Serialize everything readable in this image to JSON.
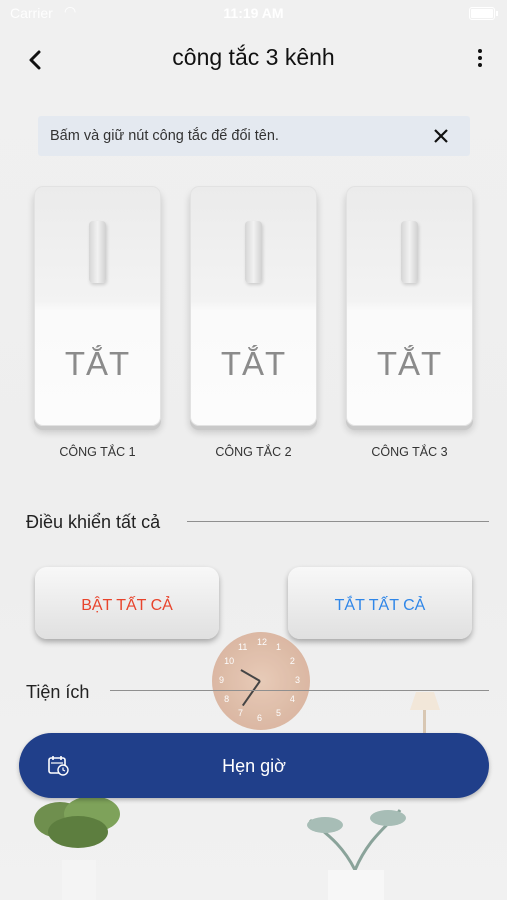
{
  "status_bar": {
    "carrier": "Carrier",
    "time": "11:19 AM"
  },
  "header": {
    "title": "công tắc 3 kênh"
  },
  "hint": {
    "text": "Bấm và giữ nút công tắc để đổi tên."
  },
  "switches": [
    {
      "state": "TẮT",
      "label": "CÔNG TẮC 1"
    },
    {
      "state": "TẮT",
      "label": "CÔNG TẮC 2"
    },
    {
      "state": "TẮT",
      "label": "CÔNG TẮC 3"
    }
  ],
  "control_all": {
    "heading": "Điều khiển tất cả",
    "on_label": "BẬT TẤT CẢ",
    "off_label": "TẮT TẤT CẢ",
    "on_color": "#e8442c",
    "off_color": "#2f86e8"
  },
  "utilities": {
    "heading": "Tiện ích"
  },
  "schedule": {
    "label": "Hẹn giờ",
    "color": "#203f8a"
  },
  "clock_numbers": [
    "12",
    "1",
    "2",
    "3",
    "4",
    "5",
    "6",
    "7",
    "8",
    "9",
    "10",
    "11"
  ]
}
